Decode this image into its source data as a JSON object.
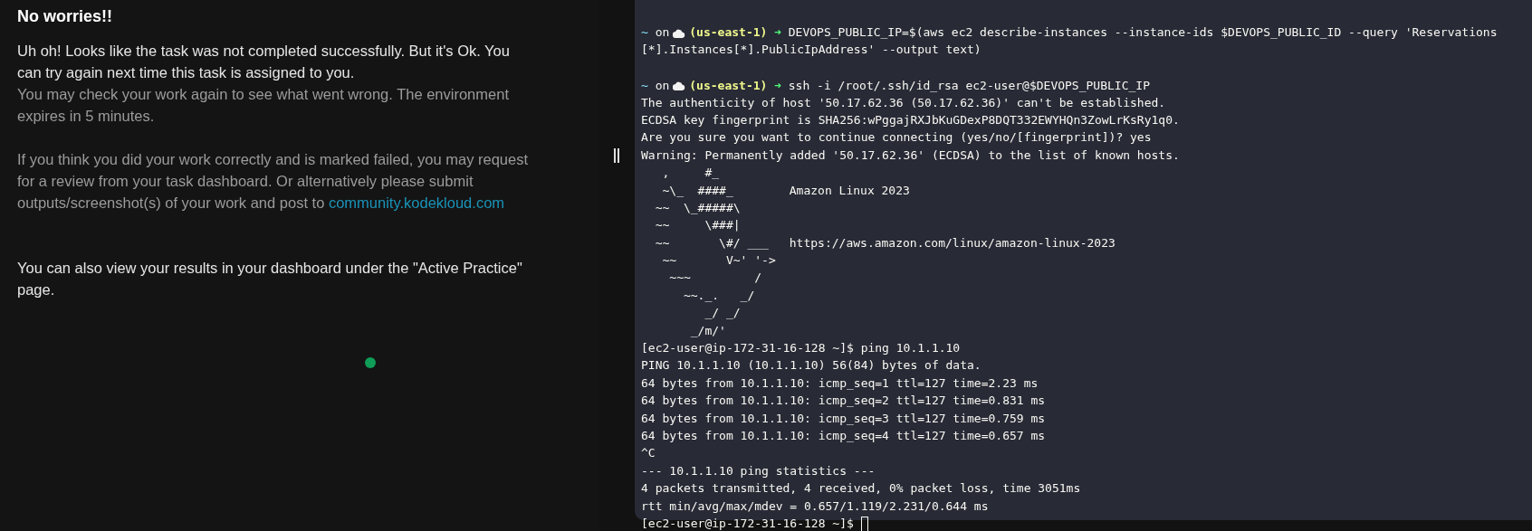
{
  "left_panel": {
    "title": "No worries!!",
    "paragraphs": [
      {
        "kind": "strong",
        "text": "Uh oh! Looks like the task was not completed successfully. But it's Ok. You can try again next time this task is assigned to you."
      },
      {
        "kind": "muted",
        "text": "You may check your work again to see what went wrong. The environment expires in 5 minutes."
      },
      {
        "kind": "muted",
        "text": "If you think you did your work correctly and is marked failed, you may request for a review from your task dashboard. Or alternatively please submit outputs/screenshot(s) of your work and post to",
        "link": "community.kodekloud.com"
      },
      {
        "kind": "strong",
        "text": "You can also view your results in your dashboard under the \"Active Practice\" page."
      }
    ]
  },
  "terminal": {
    "lines": [
      {
        "kind": "prompt",
        "dir": "~",
        "on": "on",
        "region": "(us-east-1)",
        "arrow": "➜",
        "command": "DEVOPS_PUBLIC_IP=$(aws ec2 describe-instances --instance-ids $DEVOPS_PUBLIC_ID --query 'Reservations"
      },
      {
        "kind": "output",
        "text": "[*].Instances[*].PublicIpAddress' --output text)"
      },
      {
        "kind": "blank"
      },
      {
        "kind": "prompt",
        "dir": "~",
        "on": "on",
        "region": "(us-east-1)",
        "arrow": "➜",
        "command": "ssh -i /root/.ssh/id_rsa ec2-user@$DEVOPS_PUBLIC_IP"
      },
      {
        "kind": "output",
        "text": "The authenticity of host '50.17.62.36 (50.17.62.36)' can't be established."
      },
      {
        "kind": "output",
        "text": "ECDSA key fingerprint is SHA256:wPggajRXJbKuGDexP8DQT332EWYHQn3ZowLrKsRy1q0."
      },
      {
        "kind": "output",
        "text": "Are you sure you want to continue connecting (yes/no/[fingerprint])? yes"
      },
      {
        "kind": "output",
        "text": "Warning: Permanently added '50.17.62.36' (ECDSA) to the list of known hosts."
      },
      {
        "kind": "art",
        "art": "   ,     #_"
      },
      {
        "kind": "art",
        "art": "   ~\\_  ####_",
        "note": "Amazon Linux 2023"
      },
      {
        "kind": "art",
        "art": "  ~~  \\_#####\\"
      },
      {
        "kind": "art",
        "art": "  ~~     \\###|"
      },
      {
        "kind": "art",
        "art": "  ~~       \\#/ ___",
        "note": "https://aws.amazon.com/linux/amazon-linux-2023"
      },
      {
        "kind": "art",
        "art": "   ~~       V~' '->"
      },
      {
        "kind": "art",
        "art": "    ~~~         /"
      },
      {
        "kind": "art",
        "art": "      ~~._.   _/"
      },
      {
        "kind": "art",
        "art": "         _/ _/"
      },
      {
        "kind": "art",
        "art": "       _/m/'"
      },
      {
        "kind": "output",
        "text": "[ec2-user@ip-172-31-16-128 ~]$ ping 10.1.1.10"
      },
      {
        "kind": "output",
        "text": "PING 10.1.1.10 (10.1.1.10) 56(84) bytes of data."
      },
      {
        "kind": "output",
        "text": "64 bytes from 10.1.1.10: icmp_seq=1 ttl=127 time=2.23 ms"
      },
      {
        "kind": "output",
        "text": "64 bytes from 10.1.1.10: icmp_seq=2 ttl=127 time=0.831 ms"
      },
      {
        "kind": "output",
        "text": "64 bytes from 10.1.1.10: icmp_seq=3 ttl=127 time=0.759 ms"
      },
      {
        "kind": "output",
        "text": "64 bytes from 10.1.1.10: icmp_seq=4 ttl=127 time=0.657 ms"
      },
      {
        "kind": "output",
        "text": "^C"
      },
      {
        "kind": "output",
        "text": "--- 10.1.1.10 ping statistics ---"
      },
      {
        "kind": "output",
        "text": "4 packets transmitted, 4 received, 0% packet loss, time 3051ms"
      },
      {
        "kind": "output",
        "text": "rtt min/avg/max/mdev = 0.657/1.119/2.231/0.644 ms"
      },
      {
        "kind": "cursor",
        "text": "[ec2-user@ip-172-31-16-128 ~]$"
      }
    ]
  }
}
